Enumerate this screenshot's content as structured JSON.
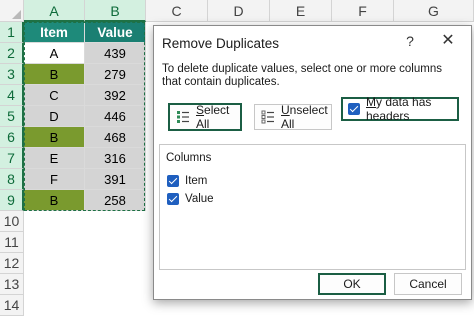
{
  "sheet": {
    "columns": [
      "A",
      "B",
      "C",
      "D",
      "E",
      "F",
      "G"
    ],
    "rows": [
      "1",
      "2",
      "3",
      "4",
      "5",
      "6",
      "7",
      "8",
      "9",
      "10",
      "11",
      "12",
      "13",
      "14"
    ],
    "header_row": [
      "Item",
      "Value"
    ],
    "data": [
      {
        "item": "A",
        "value": "439"
      },
      {
        "item": "B",
        "value": "279"
      },
      {
        "item": "C",
        "value": "392"
      },
      {
        "item": "D",
        "value": "446"
      },
      {
        "item": "B",
        "value": "468"
      },
      {
        "item": "E",
        "value": "316"
      },
      {
        "item": "F",
        "value": "391"
      },
      {
        "item": "B",
        "value": "258"
      }
    ],
    "colors": {
      "header_fill": "#1a7f72",
      "duplicate_fill": "#7a9a2e",
      "value_fill": "#d4d4d4",
      "selection_accent": "#1e7145"
    }
  },
  "dialog": {
    "title": "Remove Duplicates",
    "help_label": "?",
    "close_label": "✕",
    "description": "To delete duplicate values, select one or more columns that contain duplicates.",
    "select_all_rest": "elect All",
    "select_all_mnemonic": "S",
    "unselect_all_rest": "nselect All",
    "unselect_all_mnemonic": "U",
    "headers_rest": "y data has headers",
    "headers_mnemonic": "M",
    "headers_checked": true,
    "columns_label": "Columns",
    "column_items": [
      {
        "label": "Item",
        "checked": true
      },
      {
        "label": "Value",
        "checked": true
      }
    ],
    "ok_label": "OK",
    "cancel_label": "Cancel"
  }
}
